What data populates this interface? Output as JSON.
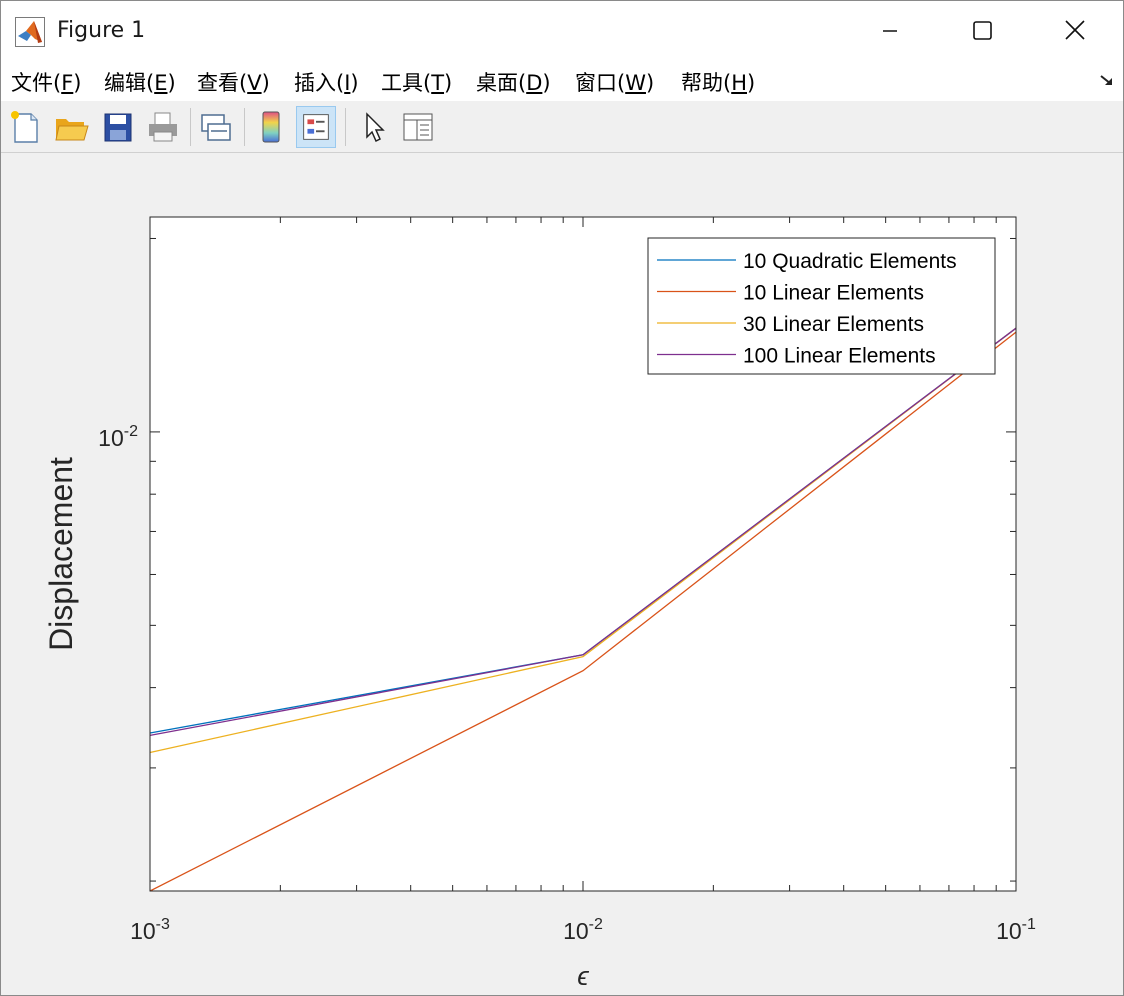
{
  "window": {
    "title": "Figure 1"
  },
  "menu": [
    {
      "label": "文件(",
      "mnemonic": "F",
      "close": ")"
    },
    {
      "label": "编辑(",
      "mnemonic": "E",
      "close": ")"
    },
    {
      "label": "查看(",
      "mnemonic": "V",
      "close": ")"
    },
    {
      "label": "插入(",
      "mnemonic": "I",
      "close": ")"
    },
    {
      "label": "工具(",
      "mnemonic": "T",
      "close": ")"
    },
    {
      "label": "桌面(",
      "mnemonic": "D",
      "close": ")"
    },
    {
      "label": "窗口(",
      "mnemonic": "W",
      "close": ")"
    },
    {
      "label": "帮助(",
      "mnemonic": "H",
      "close": ")"
    }
  ],
  "toolbar": [
    "new-figure-icon",
    "open-file-icon",
    "save-icon",
    "print-icon",
    "link-plot-icon",
    "colorbar-icon",
    "legend-icon",
    "pointer-icon",
    "property-inspector-icon"
  ],
  "chart_data": {
    "type": "line",
    "xscale": "log",
    "yscale": "log",
    "xlabel": "ϵ",
    "ylabel": "Displacement",
    "xlim": [
      0.001,
      0.1
    ],
    "ylim": [
      0.00193,
      0.0216
    ],
    "xticks": [
      0.001,
      0.01,
      0.1
    ],
    "xticklabels": [
      {
        "base": "10",
        "exp": "-3"
      },
      {
        "base": "10",
        "exp": "-2"
      },
      {
        "base": "10",
        "exp": "-1"
      }
    ],
    "yticks": [
      0.01
    ],
    "yticklabels": [
      {
        "base": "10",
        "exp": "-2"
      }
    ],
    "legend_position": "top-right",
    "series": [
      {
        "name": "10 Quadratic Elements",
        "color": "#0072bd",
        "x": [
          0.001,
          0.01,
          0.1
        ],
        "y": [
          0.0034,
          0.0045,
          0.0145
        ]
      },
      {
        "name": "10 Linear Elements",
        "color": "#d95319",
        "x": [
          0.001,
          0.01,
          0.1
        ],
        "y": [
          0.00193,
          0.00425,
          0.0143
        ]
      },
      {
        "name": "30 Linear Elements",
        "color": "#edb120",
        "x": [
          0.001,
          0.01,
          0.1
        ],
        "y": [
          0.00317,
          0.00447,
          0.0145
        ]
      },
      {
        "name": "100 Linear Elements",
        "color": "#7e2f8e",
        "x": [
          0.001,
          0.01,
          0.1
        ],
        "y": [
          0.00337,
          0.0045,
          0.0145
        ]
      }
    ]
  }
}
